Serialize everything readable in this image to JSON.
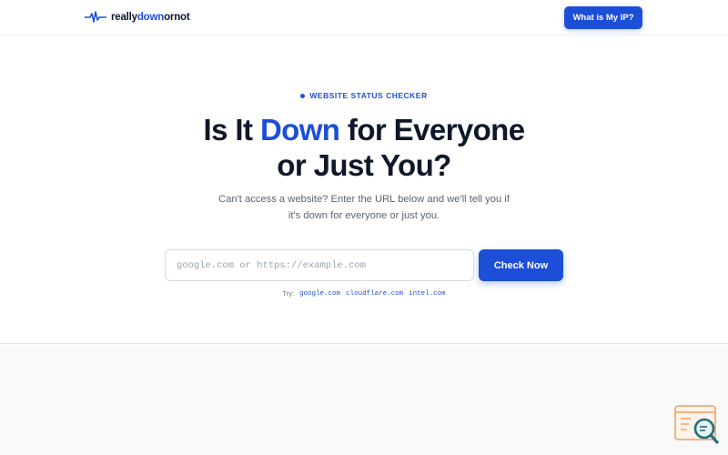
{
  "header": {
    "logo_parts": {
      "pre": "really",
      "accent": "down",
      "post": "ornot"
    },
    "logo_icon": "heartbeat-icon",
    "ip_button_label": "What is My IP?"
  },
  "hero": {
    "eyebrow": "WEBSITE STATUS CHECKER",
    "headline_line1_pre": "Is It ",
    "headline_line1_accent": "Down",
    "headline_line1_post": " for Everyone",
    "headline_line2": "or Just You?",
    "subtext_line1": "Can't access a website? Enter the URL below and we'll tell you if",
    "subtext_line2": "it's down for everyone or just you."
  },
  "search": {
    "value": "",
    "placeholder": "google.com or https://example.com",
    "button_label": "Check Now"
  },
  "try": {
    "label": "Try:",
    "examples": [
      "google.com",
      "cloudflare.com",
      "intel.com"
    ]
  },
  "widget": {
    "icon": "search-magnifier-icon"
  },
  "colors": {
    "accent": "#1d4ed8",
    "text": "#0f172a",
    "muted": "#5b6472",
    "widget_orange": "#f0a060",
    "widget_teal": "#1f6f7a"
  }
}
